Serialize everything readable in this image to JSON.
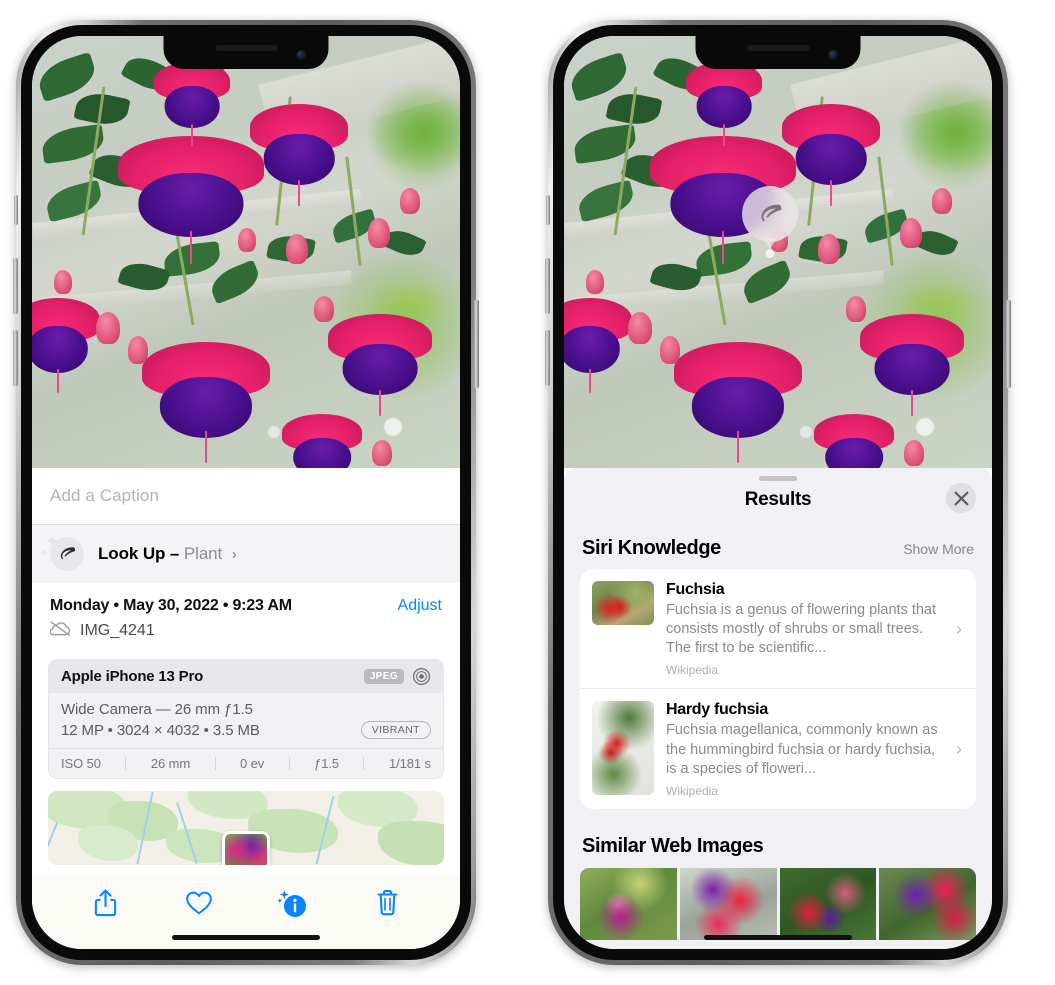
{
  "left_phone": {
    "caption_field": {
      "placeholder": "Add a Caption",
      "value": ""
    },
    "lookup_row": {
      "icon": "leaf-icon",
      "label": "Look Up –",
      "subject": "Plant",
      "chevron": "›"
    },
    "date_time": "Monday • May 30, 2022 • 9:23 AM",
    "adjust_label": "Adjust",
    "filename": "IMG_4241",
    "cloud_icon": "icloud-slash-icon",
    "metadata": {
      "device": "Apple iPhone 13 Pro",
      "format_badge": "JPEG",
      "aperture_icon": "aperture-icon",
      "lens_line": "Wide Camera — 26 mm ƒ1.5",
      "specs_line": "12 MP • 3024 × 4032 • 3.5 MB",
      "style_badge": "VIBRANT",
      "exif": [
        "ISO 50",
        "26 mm",
        "0 ev",
        "ƒ1.5",
        "1/181 s"
      ]
    },
    "toolbar": [
      {
        "name": "share-button",
        "icon": "share-icon"
      },
      {
        "name": "favorite-button",
        "icon": "heart-icon"
      },
      {
        "name": "info-button",
        "icon": "info-sparkle-icon"
      },
      {
        "name": "delete-button",
        "icon": "trash-icon"
      }
    ],
    "accent_color": "#0a84ff"
  },
  "right_phone": {
    "leaf_badge": {
      "icon": "leaf-icon"
    },
    "results_sheet": {
      "title": "Results",
      "close_icon": "close-icon",
      "siri_knowledge": {
        "section_title": "Siri Knowledge",
        "show_more": "Show More",
        "items": [
          {
            "title": "Fuchsia",
            "description": "Fuchsia is a genus of flowering plants that consists mostly of shrubs or small trees. The first to be scientific...",
            "source": "Wikipedia",
            "chevron": "›"
          },
          {
            "title": "Hardy fuchsia",
            "description": "Fuchsia magellanica, commonly known as the hummingbird fuchsia or hardy fuchsia, is a species of floweri...",
            "source": "Wikipedia",
            "chevron": "›"
          }
        ]
      },
      "similar_web_images": {
        "section_title": "Similar Web Images",
        "thumbnail_count": 4
      }
    }
  }
}
